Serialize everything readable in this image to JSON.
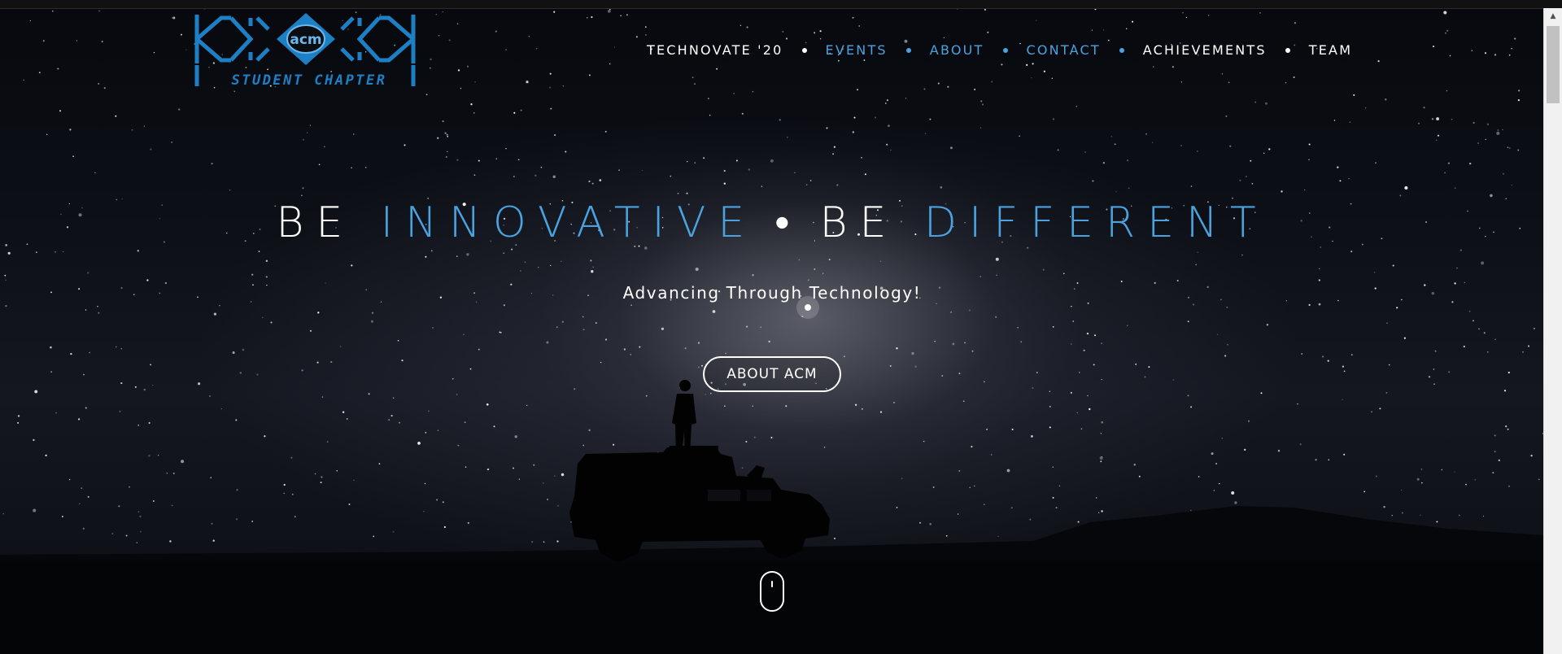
{
  "brand": {
    "logo_badge": "acm",
    "logo_text": "STUDENT CHAPTER",
    "logo_color": "#1d7fc4"
  },
  "nav": {
    "items": [
      {
        "label": "TECHNOVATE '20",
        "color": "#ffffff"
      },
      {
        "label": "EVENTS",
        "color": "#4aa3df"
      },
      {
        "label": "ABOUT",
        "color": "#4aa3df"
      },
      {
        "label": "CONTACT",
        "color": "#4aa3df"
      },
      {
        "label": "ACHIEVEMENTS",
        "color": "#ffffff"
      },
      {
        "label": "TEAM",
        "color": "#ffffff"
      }
    ],
    "dot_colors": [
      "#ffffff",
      "#4aa3df",
      "#4aa3df",
      "#4aa3df",
      "#ffffff"
    ]
  },
  "hero": {
    "headline": {
      "part1": "BE ",
      "part2": "INNOVATIVE",
      "separator": "•",
      "part3": "BE ",
      "part4": "DIFFERENT"
    },
    "tagline": "Advancing Through Technology!",
    "cta_label": "ABOUT ACM",
    "accent_color": "#4aa3df"
  },
  "icons": {
    "scroll_down": "mouse-scroll-icon",
    "scroll_up_arrow": "▲"
  }
}
